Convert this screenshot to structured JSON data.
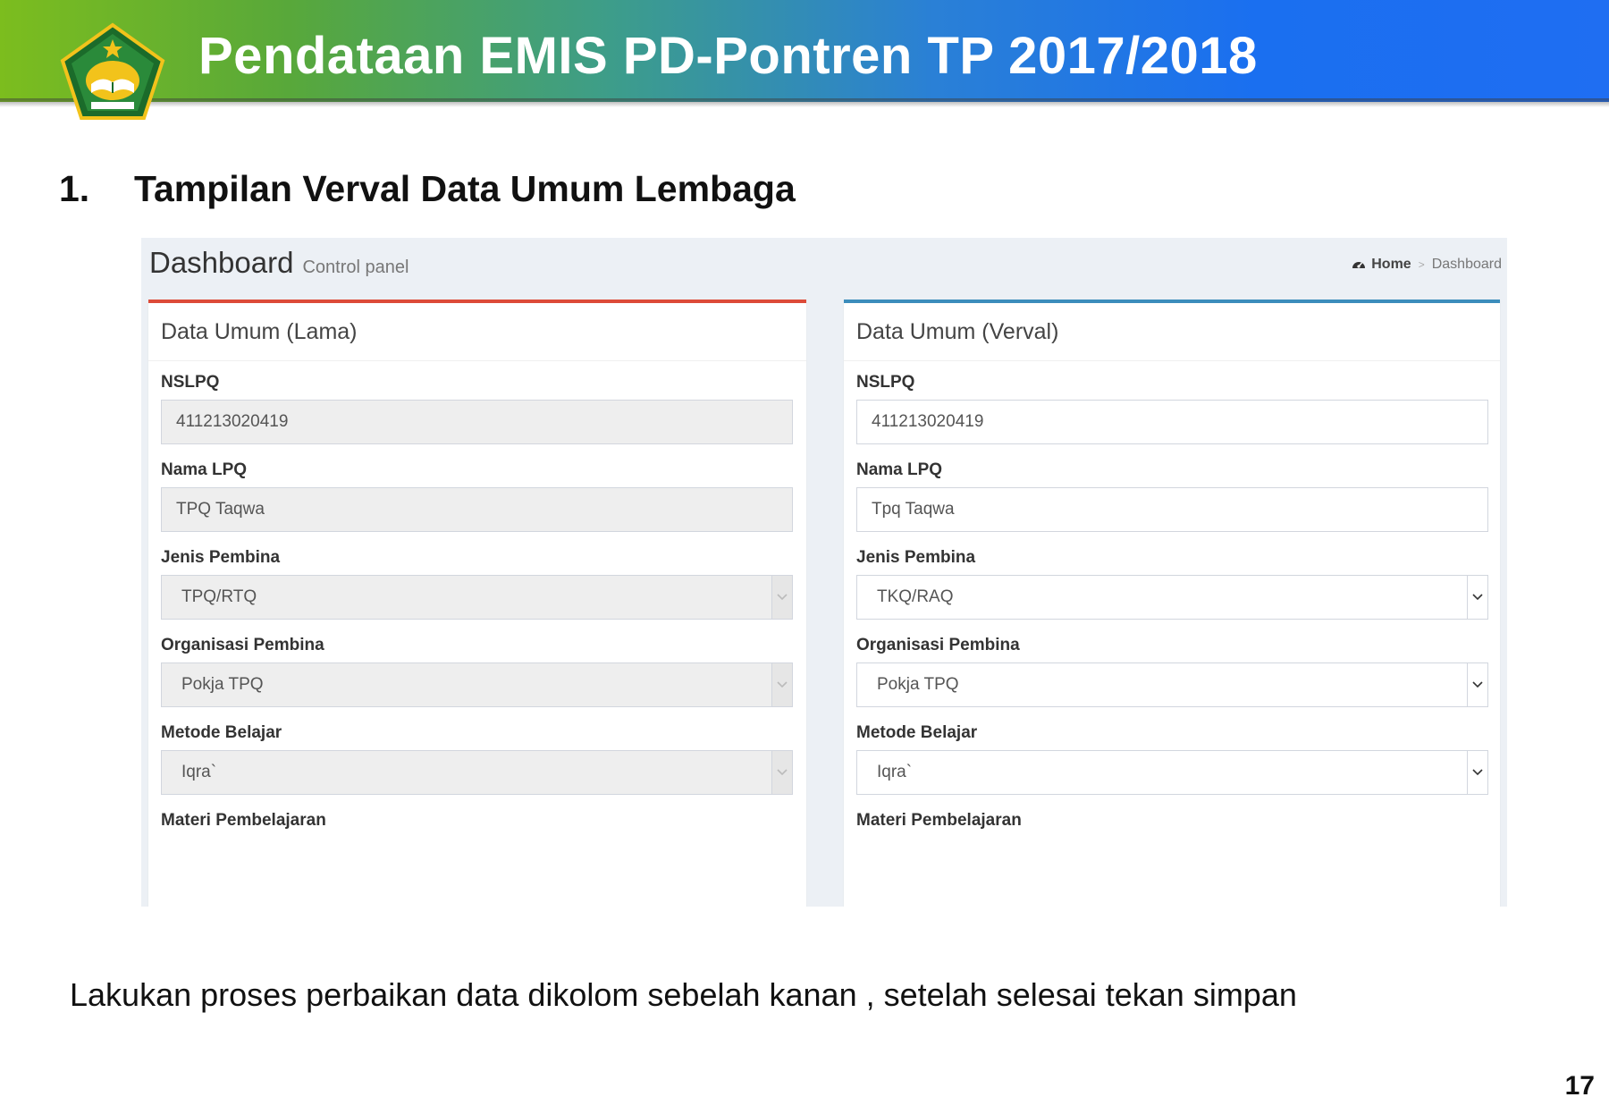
{
  "slide": {
    "title": "Pendataan EMIS PD-Pontren TP 2017/2018",
    "logo_icon": "kemenag-emblem-icon",
    "section_number": "1.",
    "section_title": "Tampilan Verval Data Umum Lembaga",
    "instruction": "Lakukan proses perbaikan data dikolom sebelah kanan , setelah selesai tekan simpan",
    "page_number": "17",
    "colors": {
      "header_start": "#7cbd1e",
      "header_end": "#1f6ef2",
      "left_box_accent": "#dd4b39",
      "right_box_accent": "#3c8dbc"
    }
  },
  "dashboard": {
    "title": "Dashboard",
    "subtitle": "Control panel",
    "breadcrumb": {
      "home_icon": "dashboard-icon",
      "home": "Home",
      "separator": ">",
      "current": "Dashboard"
    }
  },
  "left_panel": {
    "title": "Data Umum (Lama)",
    "nslpq_label": "NSLPQ",
    "nslpq_value": "411213020419",
    "nama_label": "Nama LPQ",
    "nama_value": "TPQ Taqwa",
    "jenis_label": "Jenis Pembina",
    "jenis_value": "TPQ/RTQ",
    "organisasi_label": "Organisasi Pembina",
    "organisasi_value": "Pokja TPQ",
    "metode_label": "Metode Belajar",
    "metode_value": "Iqra`",
    "materi_label": "Materi Pembelajaran"
  },
  "right_panel": {
    "title": "Data Umum (Verval)",
    "nslpq_label": "NSLPQ",
    "nslpq_value": "411213020419",
    "nama_label": "Nama LPQ",
    "nama_value": "Tpq Taqwa",
    "jenis_label": "Jenis Pembina",
    "jenis_value": "TKQ/RAQ",
    "organisasi_label": "Organisasi Pembina",
    "organisasi_value": "Pokja TPQ",
    "metode_label": "Metode Belajar",
    "metode_value": "Iqra`",
    "materi_label": "Materi Pembelajaran"
  }
}
